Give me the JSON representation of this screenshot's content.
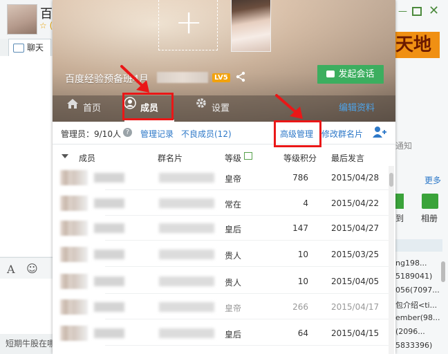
{
  "background": {
    "title": "百",
    "star": "☆ (",
    "chat_tab": "聊天",
    "font_icon": "A",
    "emoji_icon": "☺",
    "footer_text": "短期牛股在哪",
    "win_min": "—",
    "win_close": "✕",
    "banner_text": "天地",
    "notice": "通知",
    "more": "更多",
    "app1_label": "到",
    "app2_label": "相册",
    "side_lines": [
      "ng198...",
      "5189041)",
      "056(7097...",
      "包介绍<ti...",
      "ember(98...",
      "(2096...",
      "5833396)"
    ]
  },
  "group": {
    "name": "百度经验预备班4月",
    "level_badge": "LV5",
    "start_chat": "发起会话",
    "share_icon": "share-icon"
  },
  "nav": {
    "home": "首页",
    "members": "成员",
    "settings": "设置",
    "edit": "编辑资料"
  },
  "subbar": {
    "admin_count": "管理员：9/10人",
    "help": "?",
    "manage_log": "管理记录",
    "bad_members": "不良成员(12)",
    "advanced_manage": "高级管理",
    "modify_card": "修改群名片"
  },
  "table": {
    "headers": {
      "member": "成员",
      "card": "群名片",
      "level": "等级",
      "points": "等级积分",
      "last": "最后发言"
    },
    "rows": [
      {
        "level": "皇帝",
        "points": "786",
        "last": "2015/04/28",
        "dim": false
      },
      {
        "level": "常在",
        "points": "4",
        "last": "2015/04/22",
        "dim": false
      },
      {
        "level": "皇后",
        "points": "147",
        "last": "2015/04/27",
        "dim": false
      },
      {
        "level": "贵人",
        "points": "10",
        "last": "2015/03/25",
        "dim": false
      },
      {
        "level": "贵人",
        "points": "10",
        "last": "2015/04/05",
        "dim": false
      },
      {
        "level": "皇帝",
        "points": "266",
        "last": "2015/04/17",
        "dim": true
      },
      {
        "level": "皇后",
        "points": "64",
        "last": "2015/04/15",
        "dim": false
      }
    ]
  },
  "colors": {
    "accent_green": "#3cae5f",
    "link_blue": "#2d78c8",
    "annotation_red": "#ea1717",
    "badge_orange": "#f2a20c"
  }
}
